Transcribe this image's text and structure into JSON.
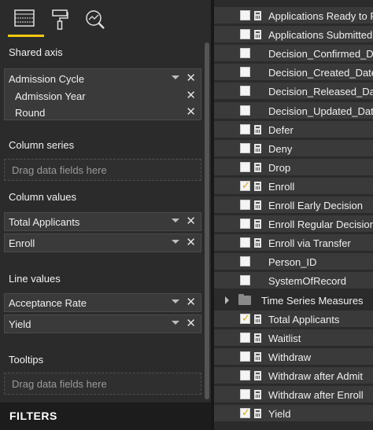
{
  "viz_tabs": [
    {
      "name": "fields-tab",
      "icon": "fields-grid-icon"
    },
    {
      "name": "format-tab",
      "icon": "paint-roller-icon"
    },
    {
      "name": "analytics-tab",
      "icon": "analytics-magnifier-icon"
    }
  ],
  "accent_color": "#f2c80f",
  "shared_axis": {
    "title": "Shared axis",
    "fields": [
      "Admission Cycle",
      "Admission Year",
      "Round"
    ]
  },
  "column_series": {
    "title": "Column series",
    "placeholder": "Drag data fields here"
  },
  "column_values": {
    "title": "Column values",
    "fields": [
      "Total Applicants",
      "Enroll"
    ]
  },
  "line_values": {
    "title": "Line values",
    "fields": [
      "Acceptance Rate",
      "Yield"
    ]
  },
  "tooltips": {
    "title": "Tooltips",
    "placeholder": "Drag data fields here"
  },
  "filters": {
    "label": "FILTERS"
  },
  "field_list": [
    {
      "label": "Applications Ready to Read",
      "checked": false,
      "icon": "calculator-icon"
    },
    {
      "label": "Applications Submitted",
      "checked": false,
      "icon": "calculator-icon"
    },
    {
      "label": "Decision_Confirmed_Date",
      "checked": false,
      "icon": ""
    },
    {
      "label": "Decision_Created_Date",
      "checked": false,
      "icon": ""
    },
    {
      "label": "Decision_Released_Date",
      "checked": false,
      "icon": ""
    },
    {
      "label": "Decision_Updated_Date",
      "checked": false,
      "icon": ""
    },
    {
      "label": "Defer",
      "checked": false,
      "icon": "calculator-icon"
    },
    {
      "label": "Deny",
      "checked": false,
      "icon": "calculator-icon"
    },
    {
      "label": "Drop",
      "checked": false,
      "icon": "calculator-icon"
    },
    {
      "label": "Enroll",
      "checked": true,
      "icon": "calculator-icon"
    },
    {
      "label": "Enroll Early Decision",
      "checked": false,
      "icon": "calculator-icon"
    },
    {
      "label": "Enroll Regular Decision",
      "checked": false,
      "icon": "calculator-icon"
    },
    {
      "label": "Enroll via Transfer",
      "checked": false,
      "icon": "calculator-icon"
    },
    {
      "label": "Person_ID",
      "checked": false,
      "icon": ""
    },
    {
      "label": "SystemOfRecord",
      "checked": false,
      "icon": ""
    }
  ],
  "field_group": {
    "label": "Time Series Measures",
    "icon": "folder-icon"
  },
  "field_list_after": [
    {
      "label": "Total Applicants",
      "checked": true,
      "icon": "calculator-icon"
    },
    {
      "label": "Waitlist",
      "checked": false,
      "icon": "calculator-icon"
    },
    {
      "label": "Withdraw",
      "checked": false,
      "icon": "calculator-icon"
    },
    {
      "label": "Withdraw after Admit",
      "checked": false,
      "icon": "calculator-icon"
    },
    {
      "label": "Withdraw after Enroll",
      "checked": false,
      "icon": "calculator-icon"
    },
    {
      "label": "Yield",
      "checked": true,
      "icon": "calculator-icon"
    }
  ]
}
